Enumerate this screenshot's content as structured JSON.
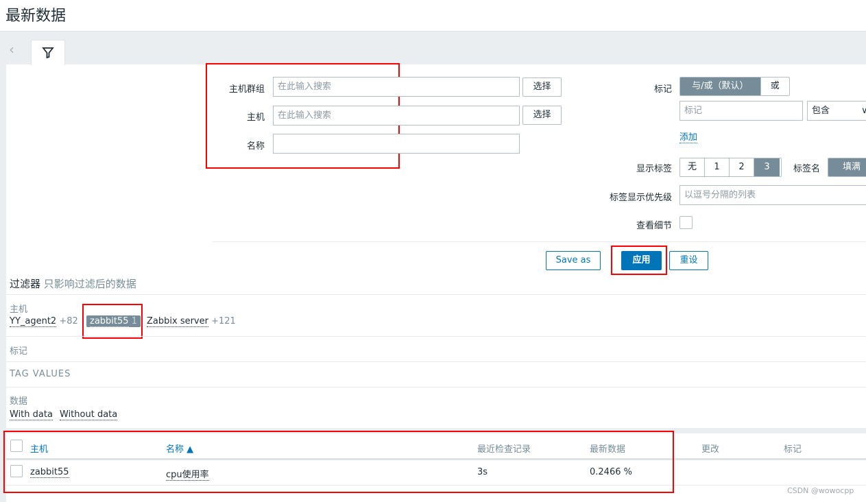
{
  "page_title": "最新数据",
  "filter": {
    "host_groups_label": "主机群组",
    "host_groups_placeholder": "在此输入搜索",
    "select_label": "选择",
    "hosts_label": "主机",
    "hosts_placeholder": "在此输入搜索",
    "name_label": "名称",
    "name_value": "",
    "tags_label": "标记",
    "tags_andor": "与/或（默认）",
    "tags_or": "或",
    "tag_placeholder": "标记",
    "tag_operator": "包含",
    "add_label": "添加",
    "show_tags_label": "显示标签",
    "show_tags_options": [
      "无",
      "1",
      "2",
      "3"
    ],
    "show_tags_selected": "3",
    "tag_name_label": "标签名",
    "tag_name_option": "填满",
    "tag_priority_label": "标签显示优先级",
    "tag_priority_placeholder": "以逗号分隔的列表",
    "show_details_label": "查看细节",
    "show_details_checked": false,
    "save_as": "Save as",
    "apply": "应用",
    "reset": "重设"
  },
  "subfilter": {
    "title": "过滤器",
    "subtitle": "只影响过滤后的数据",
    "hosts_label": "主机",
    "hosts": [
      {
        "name": "YY_agent2",
        "count": "+82",
        "selected": false
      },
      {
        "name": "zabbit55",
        "count": "1",
        "selected": true
      },
      {
        "name": "Zabbix server",
        "count": "+121",
        "selected": false
      }
    ],
    "tags_label": "标记",
    "tag_values_label": "TAG VALUES",
    "data_label": "数据",
    "data_options": [
      "With data",
      "Without data"
    ]
  },
  "table": {
    "headers": {
      "host": "主机",
      "name": "名称 ▲",
      "last_check": "最近检查记录",
      "last_value": "最新数据",
      "change": "更改",
      "tags": "标记"
    },
    "rows": [
      {
        "host": "zabbit55",
        "name": "cpu使用率",
        "last_check": "3s",
        "last_value": "0.2466 %",
        "change": "",
        "tags": ""
      }
    ]
  },
  "watermark": "CSDN @wowocpp",
  "colors": {
    "accent": "#0275b8",
    "selected": "#768d99",
    "highlight": "#ff0000"
  }
}
